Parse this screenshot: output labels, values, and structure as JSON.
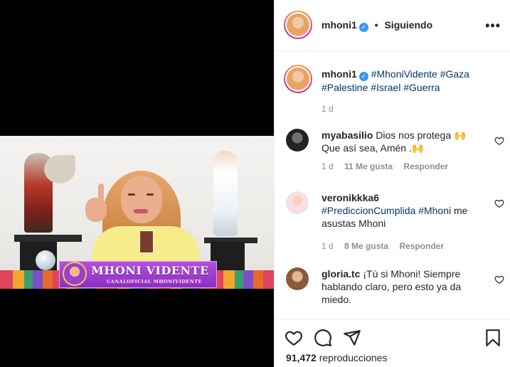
{
  "post": {
    "video_banner_title": "MHONI VIDENTE",
    "video_banner_subtitle": "CANALOFICIAL MHONIVIDENTE"
  },
  "header": {
    "username": "mhoni1",
    "separator": "•",
    "follow_status": "Siguiendo",
    "more_label": "•••"
  },
  "caption": {
    "username": "mhoni1",
    "hashtags": [
      "#MhoniVidente",
      "#Gaza",
      "#Palestine",
      "#Israel",
      "#Guerra"
    ],
    "time": "1 d"
  },
  "comments": [
    {
      "username": "myabasilio",
      "text": "Dios nos protega 🙌 Que así sea, Amén .🙌",
      "time": "1 d",
      "likes": "11 Me gusta",
      "reply_label": "Responder"
    },
    {
      "username": "veronikkka6",
      "text_prefix": "",
      "hashtags": [
        "#PrediccionCumplida",
        "#Mhoni"
      ],
      "text_suffix": "me asustas Mhoni",
      "time": "1 d",
      "likes": "8 Me gusta",
      "reply_label": "Responder"
    },
    {
      "username": "gloria.tc",
      "text": "¡Tú si Mhoni! Siempre hablando claro, pero esto ya da miedo."
    }
  ],
  "footer": {
    "views_count": "91,472",
    "views_label": "reproducciones"
  },
  "icons": {
    "like": "heart-icon",
    "comment": "comment-icon",
    "share": "share-icon",
    "save": "bookmark-icon",
    "verified": "verified-badge-icon"
  },
  "colors": {
    "link": "#00376b",
    "meta": "#8e8e8e",
    "verified": "#3897f0",
    "text": "#262626"
  }
}
